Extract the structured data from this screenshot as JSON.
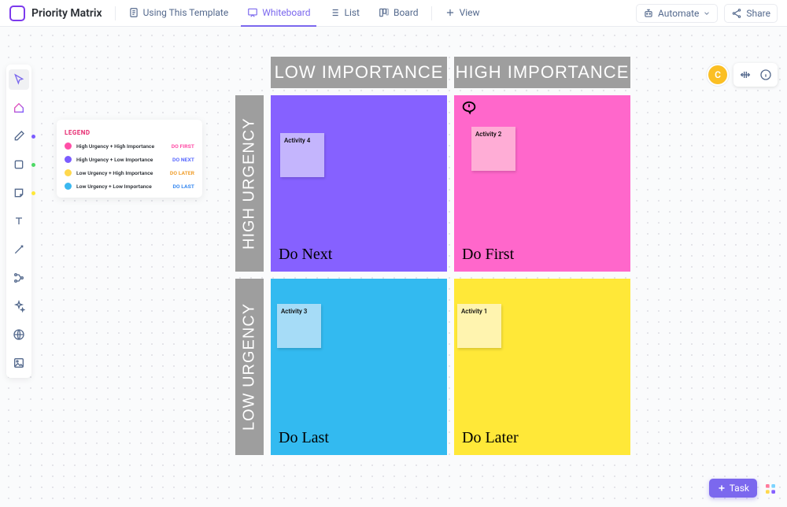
{
  "header": {
    "title": "Priority Matrix",
    "tabs": [
      {
        "label": "Using This Template"
      },
      {
        "label": "Whiteboard"
      },
      {
        "label": "List"
      },
      {
        "label": "Board"
      },
      {
        "label": "View"
      }
    ],
    "automate": "Automate",
    "share": "Share"
  },
  "avatar": "C",
  "legend": {
    "title": "LEGEND",
    "items": [
      {
        "label": "High Urgency + High Importance",
        "action": "DO FIRST",
        "color": "#ff4fa7",
        "actionColor": "#ff4fa7"
      },
      {
        "label": "High Urgency + Low Importance",
        "action": "DO NEXT",
        "color": "#7b5cff",
        "actionColor": "#5b6bff"
      },
      {
        "label": "Low Urgency + High Importance",
        "action": "DO LATER",
        "color": "#ffd84d",
        "actionColor": "#f0a030"
      },
      {
        "label": "Low Urgency + Low Importance",
        "action": "DO LAST",
        "color": "#3bb8f0",
        "actionColor": "#3b8bf0"
      }
    ]
  },
  "matrix": {
    "colHeaders": [
      "LOW IMPORTANCE",
      "HIGH IMPORTANCE"
    ],
    "rowHeaders": [
      "HIGH URGENCY",
      "LOW URGENCY"
    ],
    "quadrants": {
      "topLeft": {
        "label": "Do Next",
        "bg": "#8661ff",
        "sticky": {
          "text": "Activity 4",
          "bg": "#c4b5fd"
        }
      },
      "topRight": {
        "label": "Do First",
        "bg": "#ff67cb",
        "sticky": {
          "text": "Activity 2",
          "bg": "#ffadd6"
        }
      },
      "botLeft": {
        "label": "Do Last",
        "bg": "#33baf0",
        "sticky": {
          "text": "Activity 3",
          "bg": "#a6dcf7"
        }
      },
      "botRight": {
        "label": "Do Later",
        "bg": "#ffe838",
        "sticky": {
          "text": "Activity 1",
          "bg": "#fff4af"
        }
      }
    }
  },
  "taskBtn": "Task"
}
